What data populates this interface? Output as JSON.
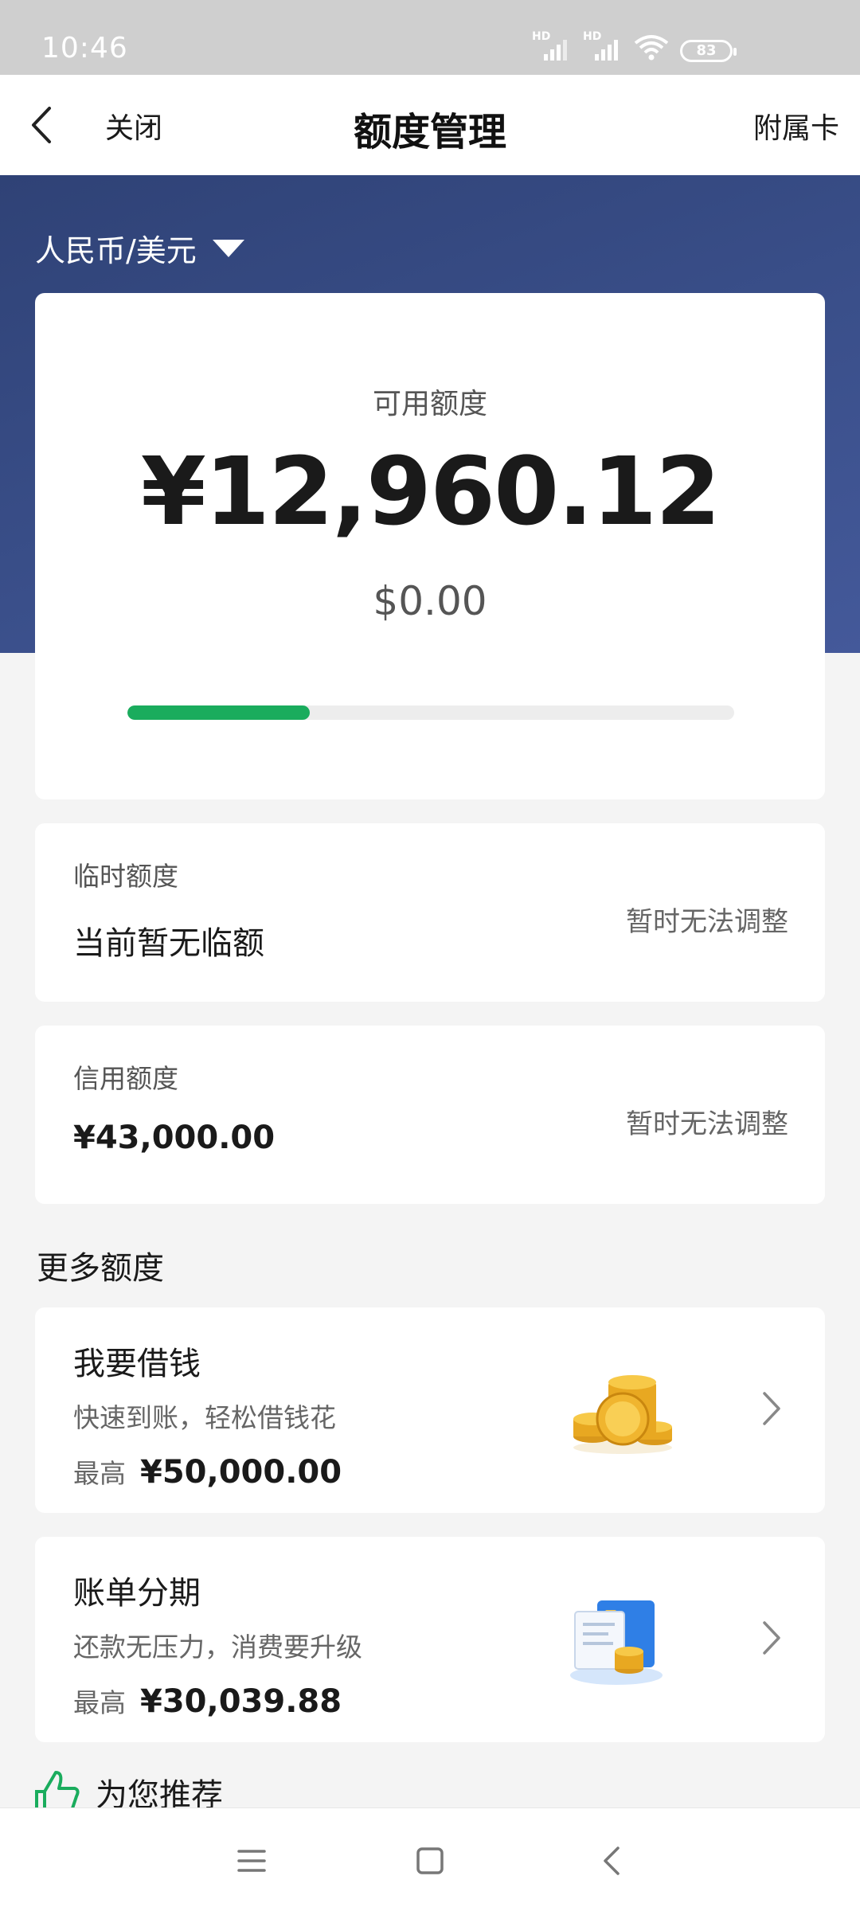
{
  "status_bar": {
    "time": "10:46",
    "battery": "83",
    "signal_labels": [
      "HD",
      "HD"
    ],
    "icons": [
      "signal-icon",
      "signal-icon",
      "wifi-icon",
      "battery-icon"
    ]
  },
  "nav": {
    "close_label": "关闭",
    "title": "额度管理",
    "right_label": "附属卡",
    "back_icon": "back-chevron-icon"
  },
  "currency_selector": {
    "value": "人民币/美元",
    "icon": "caret-down-icon"
  },
  "available": {
    "label": "可用额度",
    "amount_cny": "¥12,960.12",
    "amount_usd": "$0.00",
    "progress_fraction": 0.3,
    "progress_color": "#1aac5d"
  },
  "temporary": {
    "label": "临时额度",
    "value": "当前暂无临额",
    "action": "暂时无法调整"
  },
  "credit": {
    "label": "信用额度",
    "value": "¥43,000.00",
    "action": "暂时无法调整"
  },
  "more_section": {
    "title": "更多额度"
  },
  "promos": {
    "loan": {
      "title": "我要借钱",
      "desc": "快速到账，轻松借钱花",
      "limit_label": "最高",
      "limit_value": "¥50,000.00",
      "icon": "gold-coins-icon"
    },
    "installment": {
      "title": "账单分期",
      "desc": "还款无压力，消费要升级",
      "limit_label": "最高",
      "limit_value": "¥30,039.88",
      "icon": "bill-card-coins-icon"
    }
  },
  "recommend": {
    "title": "为您推荐",
    "icon": "thumbs-up-icon"
  },
  "system_nav": {
    "buttons": [
      "menu-icon",
      "home-icon",
      "back-icon"
    ]
  },
  "colors": {
    "hero_blue": "#3a4f8a",
    "accent_green": "#1aac5d",
    "background": "#f4f4f4"
  }
}
